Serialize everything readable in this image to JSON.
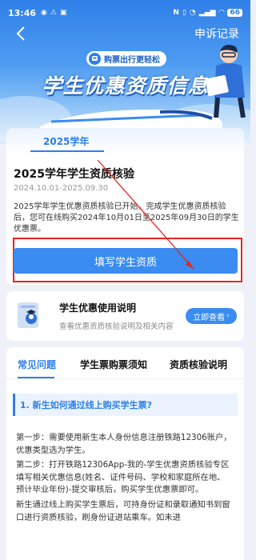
{
  "status_bar": {
    "time": "13:46",
    "battery": "66"
  },
  "nav": {
    "back_icon": "chevron-left-icon",
    "appeal_label": "申诉记录"
  },
  "hero": {
    "promo_pill": "购票出行更轻松",
    "title": "学生优惠资质信息"
  },
  "card": {
    "year_tab": "2025学年",
    "title": "2025学年学生资质核验",
    "date_range": "2024.10.01-2025.09.30",
    "description": "2025学年学生优惠资质核验已开始，完成学生优惠资质核验后，您可在线购买2024年10月01日至2025年09月30日的学生优惠票。",
    "fill_button": "填写学生资质"
  },
  "guide": {
    "title": "学生优惠使用说明",
    "subtitle": "查看优惠资质核验说明及相关内容",
    "button": "立即查看"
  },
  "faq": {
    "tabs": [
      "常见问题",
      "学生票购票须知",
      "资质核验说明"
    ],
    "active_tab": 0,
    "question": "1. 新生如何通过线上购买学生票?",
    "answer": [
      "第一步：需要使用新生本人身份信息注册铁路12306账户，优惠类型选为学生。",
      "第二步：打开铁路12306App-我的-学生优惠资质核验专区填写相关优惠信息(姓名、证件号码、学校和家庭所在地、预计毕业年份)-提交审核后，购买学生优惠票即可。",
      "新生通过线上购买学生票后，可持身份证和录取通知书到窗口进行资质核验，刷身份证进站乘车。如未进"
    ]
  },
  "colors": {
    "accent": "#3a8cf0",
    "highlight_border": "#e8231f"
  }
}
